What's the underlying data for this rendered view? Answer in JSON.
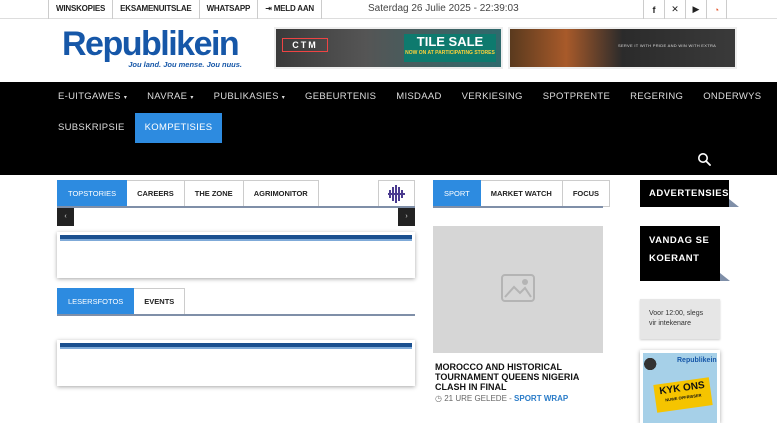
{
  "topbar": {
    "links": [
      "WINSKOPIES",
      "EKSAMENUITSLAE",
      "WHATSAPP",
      "MELD AAN"
    ],
    "login_icon": "login-icon",
    "date": "Saterdag 26 Julie 2025 - 22:39:03",
    "socials": [
      "facebook-icon",
      "x-icon",
      "youtube-icon",
      "rss-icon"
    ],
    "social_glyphs": [
      "f",
      "✕",
      "▶",
      "◔"
    ]
  },
  "header": {
    "logo_name": "Republikein",
    "logo_tagline": "Jou land. Jou mense. Jou nuus.",
    "ad1": {
      "brand": "CTM",
      "headline": "TILE SALE",
      "subline": "NOW ON AT PARTICIPATING STORES"
    },
    "ad2": {
      "text": "SERVE IT WITH PRIDE AND WIN WITH EXTRA"
    }
  },
  "nav": {
    "row1": [
      {
        "label": "E-UITGAWES",
        "dropdown": true
      },
      {
        "label": "NAVRAE",
        "dropdown": true
      },
      {
        "label": "PUBLIKASIES",
        "dropdown": true
      },
      {
        "label": "GEBEURTENIS",
        "dropdown": false
      },
      {
        "label": "MISDAAD",
        "dropdown": false
      },
      {
        "label": "VERKIESING",
        "dropdown": false
      },
      {
        "label": "SPOTPRENTE",
        "dropdown": false
      },
      {
        "label": "REGERING",
        "dropdown": false
      },
      {
        "label": "ONDERWYS",
        "dropdown": false
      }
    ],
    "row2": [
      {
        "label": "SUBSKRIPSIE",
        "active": false
      },
      {
        "label": "KOMPETISIES",
        "active": true
      }
    ],
    "caret": "▾"
  },
  "tabs_top": [
    "TOPSTORIES",
    "CAREERS",
    "THE ZONE",
    "AGRIMONITOR"
  ],
  "slider": {
    "prev": "‹",
    "next": "›"
  },
  "tabs_readers": [
    "LESERSFOTOS",
    "EVENTS"
  ],
  "tabs_sport": [
    "SPORT",
    "MARKET WATCH",
    "FOCUS"
  ],
  "article": {
    "headline": "MOROCCO AND HISTORICAL TOURNAMENT QUEENS NIGERIA CLASH IN FINAL",
    "time": "21 URE GELEDE",
    "separator": " - ",
    "category": "SPORT WRAP"
  },
  "sidebar": {
    "ads_title": "ADVERTENSIES",
    "today_title_line1": "VANDAG SE",
    "today_title_line2": "KOERANT",
    "notice": "Voor 12:00, slegs vir intekenare",
    "promo": {
      "logo": "Republikein",
      "badge_line1": "KYK ONS",
      "badge_line2": "NUWE OPFRISSER"
    }
  },
  "colors": {
    "brand_blue": "#1657a8",
    "accent_blue": "#2d8be0",
    "nav_bg": "#000000",
    "link_blue": "#2a7cc8"
  }
}
